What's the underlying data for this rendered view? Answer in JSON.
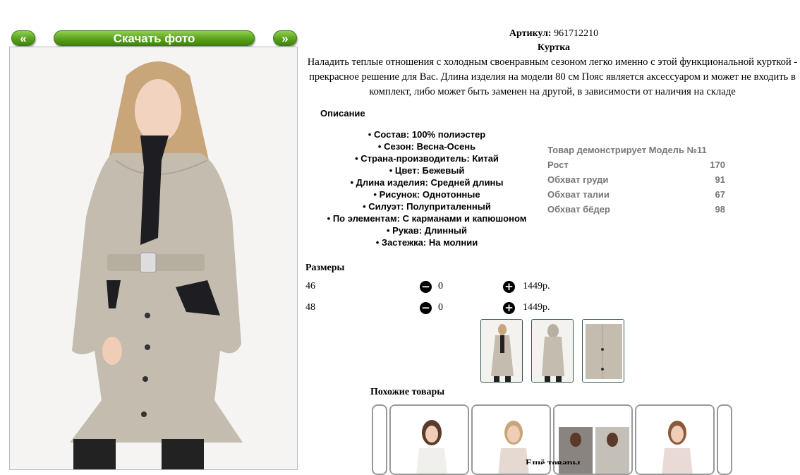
{
  "gallery": {
    "prev_label": "«",
    "download_label": "Скачать фото",
    "next_label": "»"
  },
  "product": {
    "article_label": "Артикул:",
    "article_value": "961712210",
    "name": "Куртка",
    "description": "Наладить теплые отношения с холодным своенравным сезоном легко именно с этой функциональной курткой - прекрасное решение для Вас. Длина изделия на модели 80 см Пояс является аксессуаром и может не входить в комплект, либо может быть заменен на другой, в зависимости от наличия на складе",
    "description_title": "Описание",
    "specs": [
      "Состав: 100% полиэстер",
      "Сезон: Весна-Осень",
      "Страна-производитель: Китай",
      "Цвет: Бежевый",
      "Длина изделия: Средней длины",
      "Рисунок: Однотонные",
      "Силуэт: Полуприталенный",
      "По элементам: С карманами и капюшоном",
      "Рукав: Длинный",
      "Застежка: На молнии"
    ]
  },
  "model": {
    "title": "Товар демонстрирует Модель №11",
    "rows": [
      {
        "label": "Рост",
        "value": "170"
      },
      {
        "label": "Обхват груди",
        "value": "91"
      },
      {
        "label": "Обхват талии",
        "value": "67"
      },
      {
        "label": "Обхват бёдер",
        "value": "98"
      }
    ]
  },
  "sizes": {
    "title": "Размеры",
    "rows": [
      {
        "size": "46",
        "qty": "0",
        "price": "1449р."
      },
      {
        "size": "48",
        "qty": "0",
        "price": "1449р."
      }
    ]
  },
  "similar": {
    "title": "Похожие товары"
  },
  "footer_partial": "Ещё товары"
}
